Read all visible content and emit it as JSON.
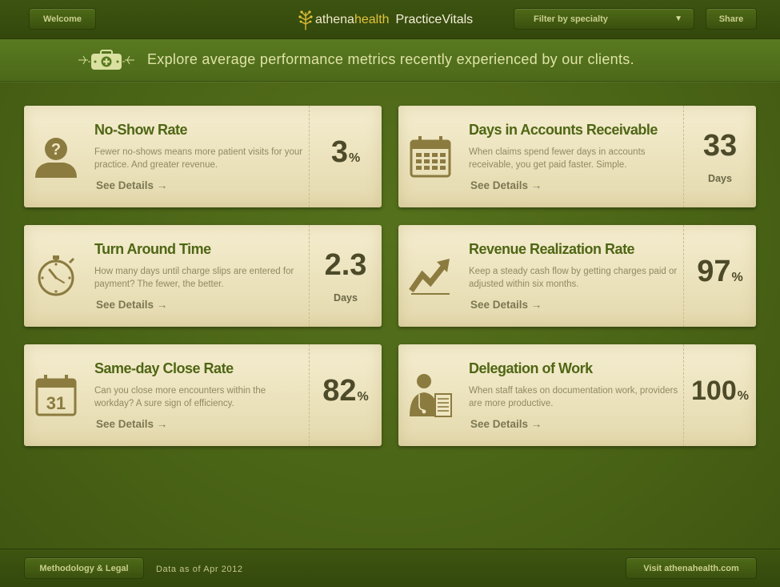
{
  "header": {
    "welcome_label": "Welcome",
    "brand_athena": "athena",
    "brand_health": "health",
    "brand_product": "PracticeVitals",
    "filter_label": "Filter by specialty",
    "share_label": "Share"
  },
  "banner": {
    "text": "Explore average performance metrics recently experienced by our clients."
  },
  "cards": [
    {
      "title": "No-Show Rate",
      "desc": "Fewer no-shows means more patient visits for your practice. And greater revenue.",
      "details": "See Details →",
      "value": "3",
      "unit": "%",
      "unit_below": "",
      "icon": "question-person-icon"
    },
    {
      "title": "Days in Accounts Receivable",
      "desc": "When claims spend fewer days in accounts receivable, you get paid faster. Simple.",
      "details": "See Details →",
      "value": "33",
      "unit": "",
      "unit_below": "Days",
      "icon": "calendar-icon"
    },
    {
      "title": "Turn Around Time",
      "desc": "How many days until charge slips are entered for payment? The fewer, the better.",
      "details": "See Details →",
      "value": "2.3",
      "unit": "",
      "unit_below": "Days",
      "icon": "stopwatch-icon"
    },
    {
      "title": "Revenue Realization Rate",
      "desc": "Keep a steady cash flow by getting charges paid or adjusted within six months.",
      "details": "See Details →",
      "value": "97",
      "unit": "%",
      "unit_below": "",
      "icon": "trend-up-arrow-icon"
    },
    {
      "title": "Same-day Close Rate",
      "desc": "Can you close more encounters within the workday? A sure sign of efficiency.",
      "details": "See Details →",
      "value": "82",
      "unit": "%",
      "unit_below": "",
      "icon": "calendar-31-icon",
      "icon_text": "31"
    },
    {
      "title": "Delegation of Work",
      "desc": "When staff takes on documentation work, providers are more productive.",
      "details": "See Details →",
      "value": "100",
      "unit": "%",
      "unit_below": "",
      "icon": "doctor-document-icon"
    }
  ],
  "footer": {
    "method_label": "Methodology & Legal",
    "data_as_of": "Data as of Apr 2012",
    "visit_label": "Visit athenahealth.com"
  },
  "colors": {
    "background": "#4a6416",
    "card": "#efe6c3",
    "title_green": "#4f6614",
    "brand_yellow": "#e3c43b"
  }
}
